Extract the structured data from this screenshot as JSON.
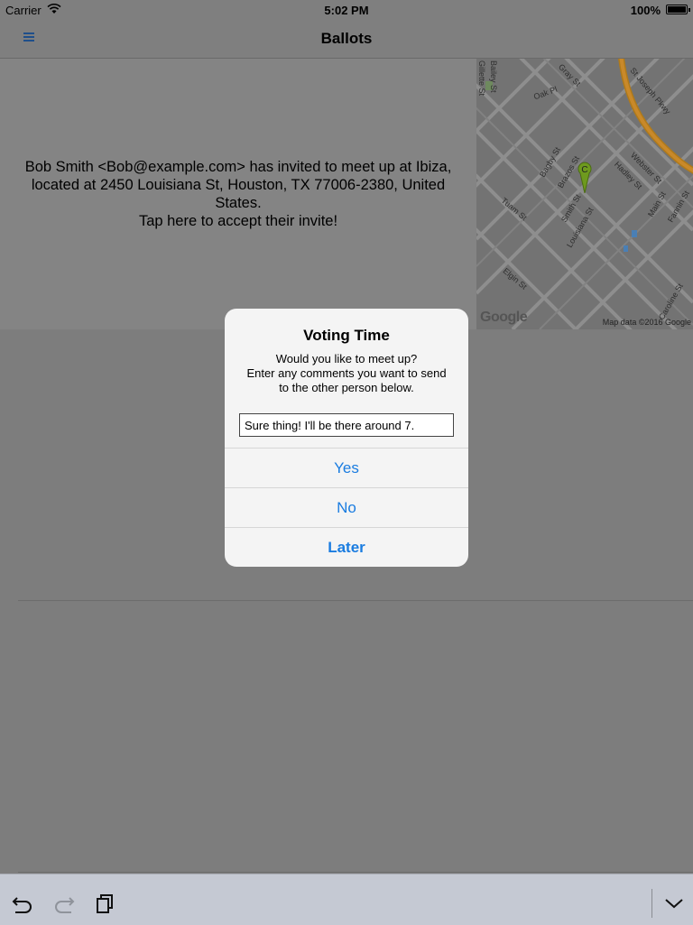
{
  "status_bar": {
    "carrier": "Carrier",
    "time": "5:02 PM",
    "battery": "100%"
  },
  "nav": {
    "title": "Ballots",
    "menu_icon": "hamburger-menu-icon"
  },
  "invite": {
    "line1": "Bob Smith <Bob@example.com> has invited to meet up at Ibiza, located at 2450 Louisiana St, Houston, TX  77006-2380, United States.",
    "line2": "Tap here to accept their invite!"
  },
  "map": {
    "streets": [
      "Gray St",
      "St Joseph Pkwy",
      "Bailey St",
      "Gillette St",
      "Oak Pl",
      "Bagby St",
      "Brazos St",
      "Smith St",
      "Louisiana St",
      "Webster St",
      "Hadley St",
      "Main St",
      "Fannin St",
      "Tuam St",
      "Elgin St",
      "Caroline St"
    ],
    "pin_label": "C",
    "logo": "Google",
    "credit": "Map data ©2016 Google"
  },
  "alert": {
    "title": "Voting Time",
    "message_lines": [
      "Would you like to meet up?",
      "Enter any comments you want to send",
      "to the other person below."
    ],
    "input_value": "Sure thing! I'll be there around 7.",
    "buttons": {
      "yes": "Yes",
      "no": "No",
      "later": "Later"
    }
  },
  "toolbar": {
    "icons": [
      "undo-icon",
      "redo-icon",
      "paste-icon",
      "chevron-down-icon"
    ]
  },
  "colors": {
    "accent": "#1a7ce0",
    "nav_icon": "#1f4f8a",
    "dim_background": "#7d7d7d",
    "alert_background": "#f4f4f4",
    "toolbar_background": "#c5c9d3"
  }
}
